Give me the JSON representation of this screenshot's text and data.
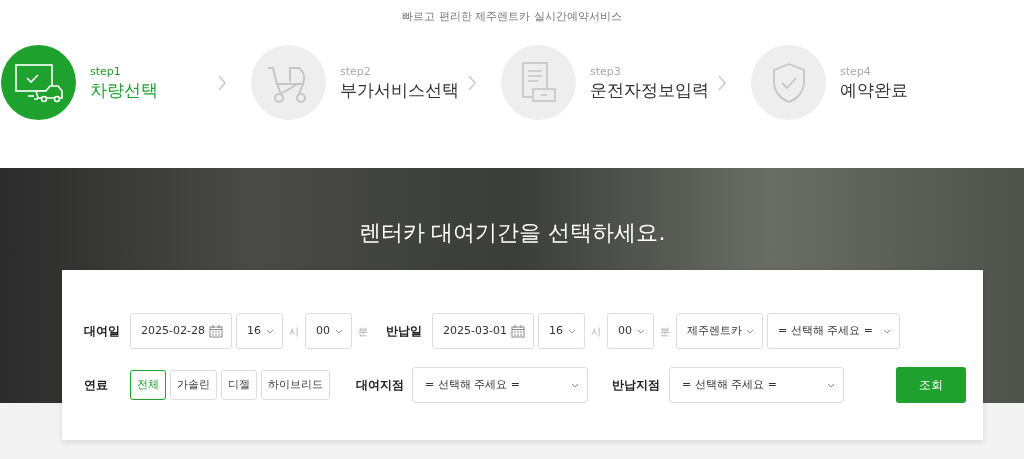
{
  "subtitle": "빠르고 편리한 제주렌트카 실시간예약서비스",
  "steps": [
    {
      "kind": "car",
      "number": "step1",
      "label": "차량선택",
      "selected": true
    },
    {
      "kind": "stroller",
      "number": "step2",
      "label": "부가서비스선택",
      "selected": false
    },
    {
      "kind": "document",
      "number": "step3",
      "label": "운전자정보입력",
      "selected": false
    },
    {
      "kind": "shield",
      "number": "step4",
      "label": "예약완료",
      "selected": false
    }
  ],
  "hero": {
    "title": "렌터카 대여기간을 선택하세요."
  },
  "search": {
    "rental": {
      "label": "대여일",
      "date": "2025-02-28",
      "hour": "16",
      "hour_unit": "시",
      "minute": "00",
      "minute_unit": "분"
    },
    "return": {
      "label": "반납일",
      "date": "2025-03-01",
      "hour": "16",
      "hour_unit": "시",
      "minute": "00",
      "minute_unit": "분"
    },
    "company": "제주렌트카",
    "car_select": "= 선택해 주세요 =",
    "fuel": {
      "label": "연료",
      "options": [
        {
          "label": "전체",
          "selected": true
        },
        {
          "label": "가솔린",
          "selected": false
        },
        {
          "label": "디젤",
          "selected": false
        },
        {
          "label": "하이브리드",
          "selected": false
        }
      ]
    },
    "pickup": {
      "label": "대여지점",
      "value": "= 선택해 주세요 ="
    },
    "dropoff": {
      "label": "반납지점",
      "value": "= 선택해 주세요 ="
    },
    "button": "조회"
  }
}
